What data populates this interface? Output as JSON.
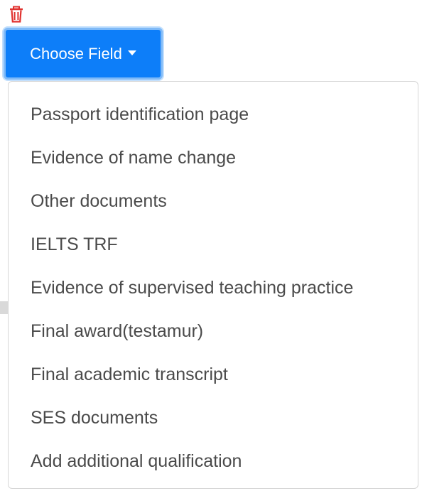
{
  "toolbar": {
    "delete_icon": "trash-icon",
    "delete_color": "#e0322f"
  },
  "dropdown": {
    "button_label": "Choose Field",
    "button_color": "#0d7ef9",
    "caret_icon": "caret-down-icon",
    "items": [
      "Passport identification page",
      "Evidence of name change",
      "Other documents",
      "IELTS TRF",
      "Evidence of supervised teaching practice",
      "Final award(testamur)",
      "Final academic transcript",
      "SES documents",
      "Add additional qualification"
    ]
  }
}
